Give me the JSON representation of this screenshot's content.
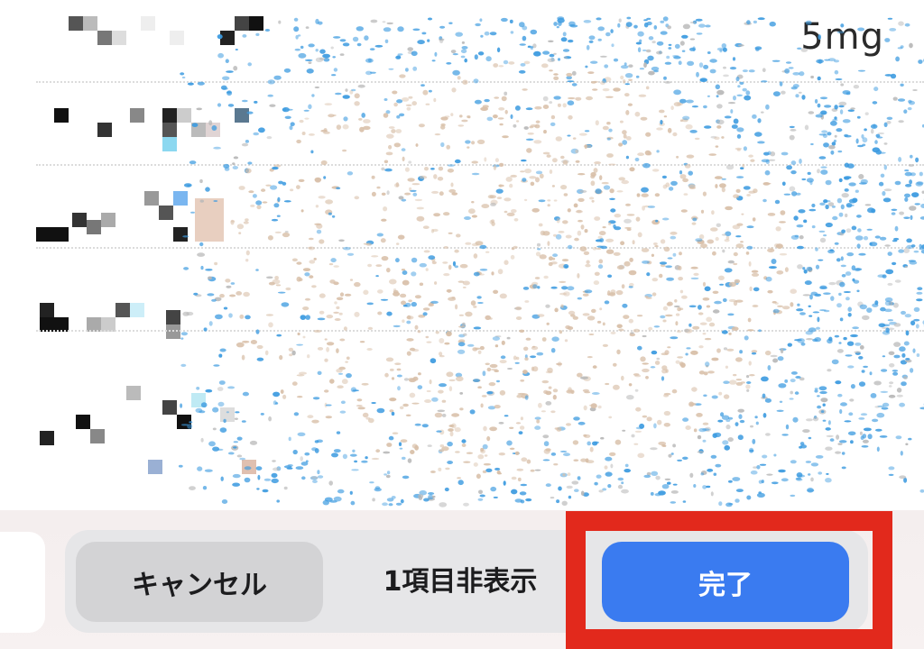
{
  "list": {
    "rows": [
      {
        "value": "5mg"
      },
      {
        "value": ""
      },
      {
        "value": ""
      },
      {
        "value": ""
      },
      {
        "value": ""
      }
    ]
  },
  "toolbar": {
    "cancel_label": "キャンセル",
    "hidden_count_label": "1項目非表示",
    "done_label": "完了"
  },
  "colors": {
    "done_button": "#3a7bf0",
    "highlight_box": "#e2291c",
    "particle_blue": "#3d9be0",
    "particle_beige": "#d8bfa8"
  }
}
